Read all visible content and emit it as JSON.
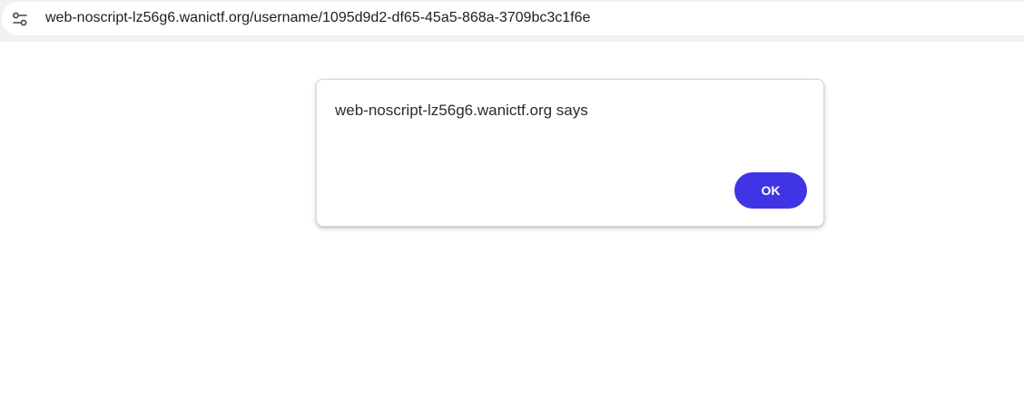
{
  "browser": {
    "address_bar": {
      "url": "web-noscript-lz56g6.wanictf.org/username/1095d9d2-df65-45a5-868a-3709bc3c1f6e",
      "site_info_icon": "tune-icon"
    }
  },
  "dialog": {
    "title": "web-noscript-lz56g6.wanictf.org says",
    "message": "",
    "ok_label": "OK",
    "accent_color": "#4035e5"
  }
}
